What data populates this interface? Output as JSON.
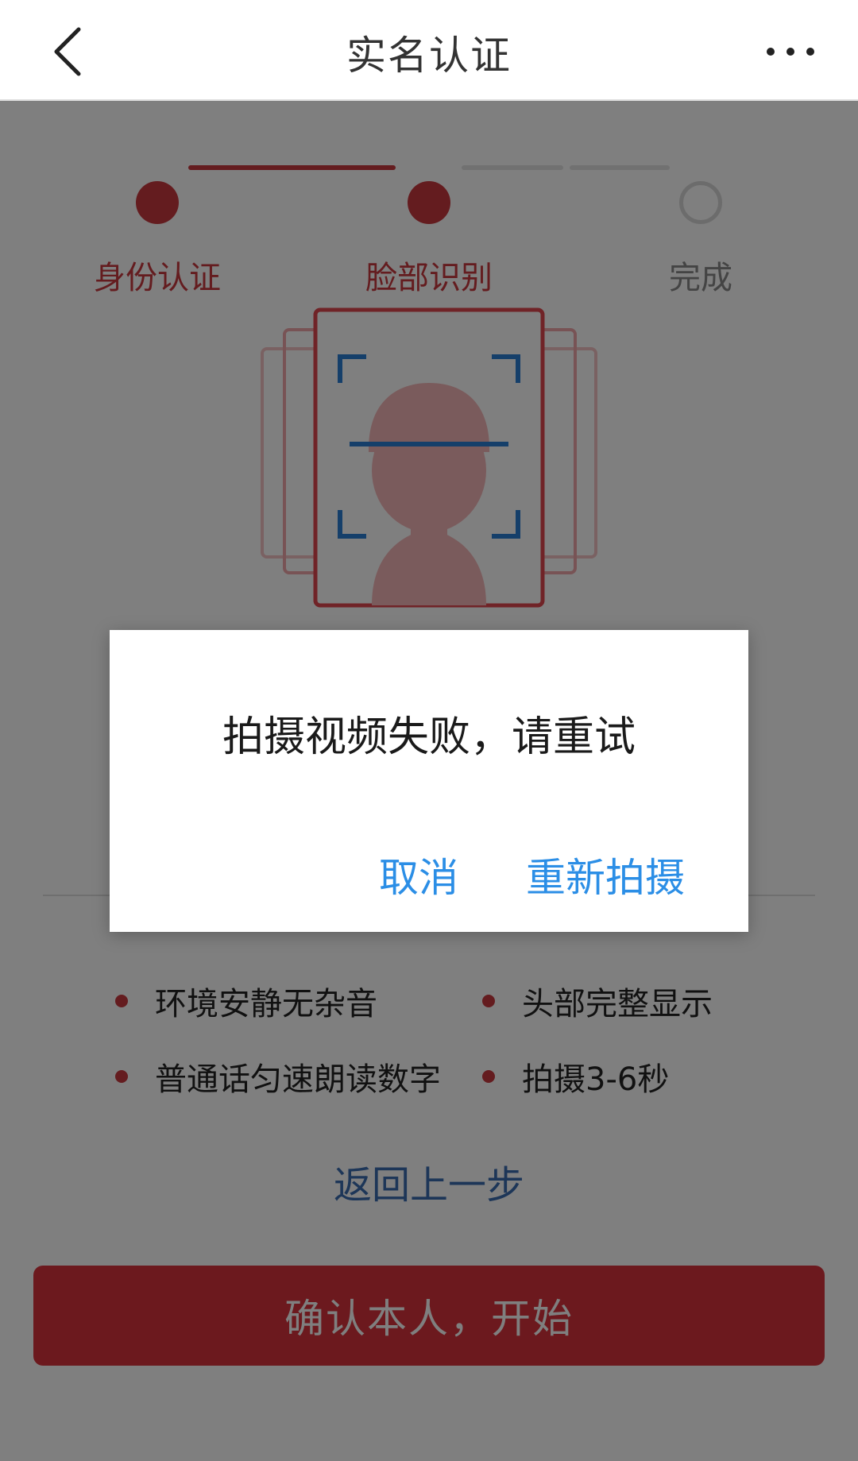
{
  "header": {
    "title": "实名认证",
    "back_icon": "chevron-left-icon",
    "more_icon": "more-horizontal-icon"
  },
  "steps": [
    {
      "label": "身份认证",
      "status": "done"
    },
    {
      "label": "脸部识别",
      "status": "active"
    },
    {
      "label": "完成",
      "status": "pending"
    }
  ],
  "tips": [
    "环境安静无杂音",
    "头部完整显示",
    "普通话匀速朗读数字",
    "拍摄3-6秒"
  ],
  "back_link": "返回上一步",
  "confirm_button": "确认本人，开始",
  "dialog": {
    "message": "拍摄视频失败，请重试",
    "cancel": "取消",
    "retry": "重新拍摄"
  },
  "colors": {
    "brand_red": "#d9333c",
    "link_blue": "#3b6cb0",
    "dialog_button_blue": "#2b8ee6"
  }
}
